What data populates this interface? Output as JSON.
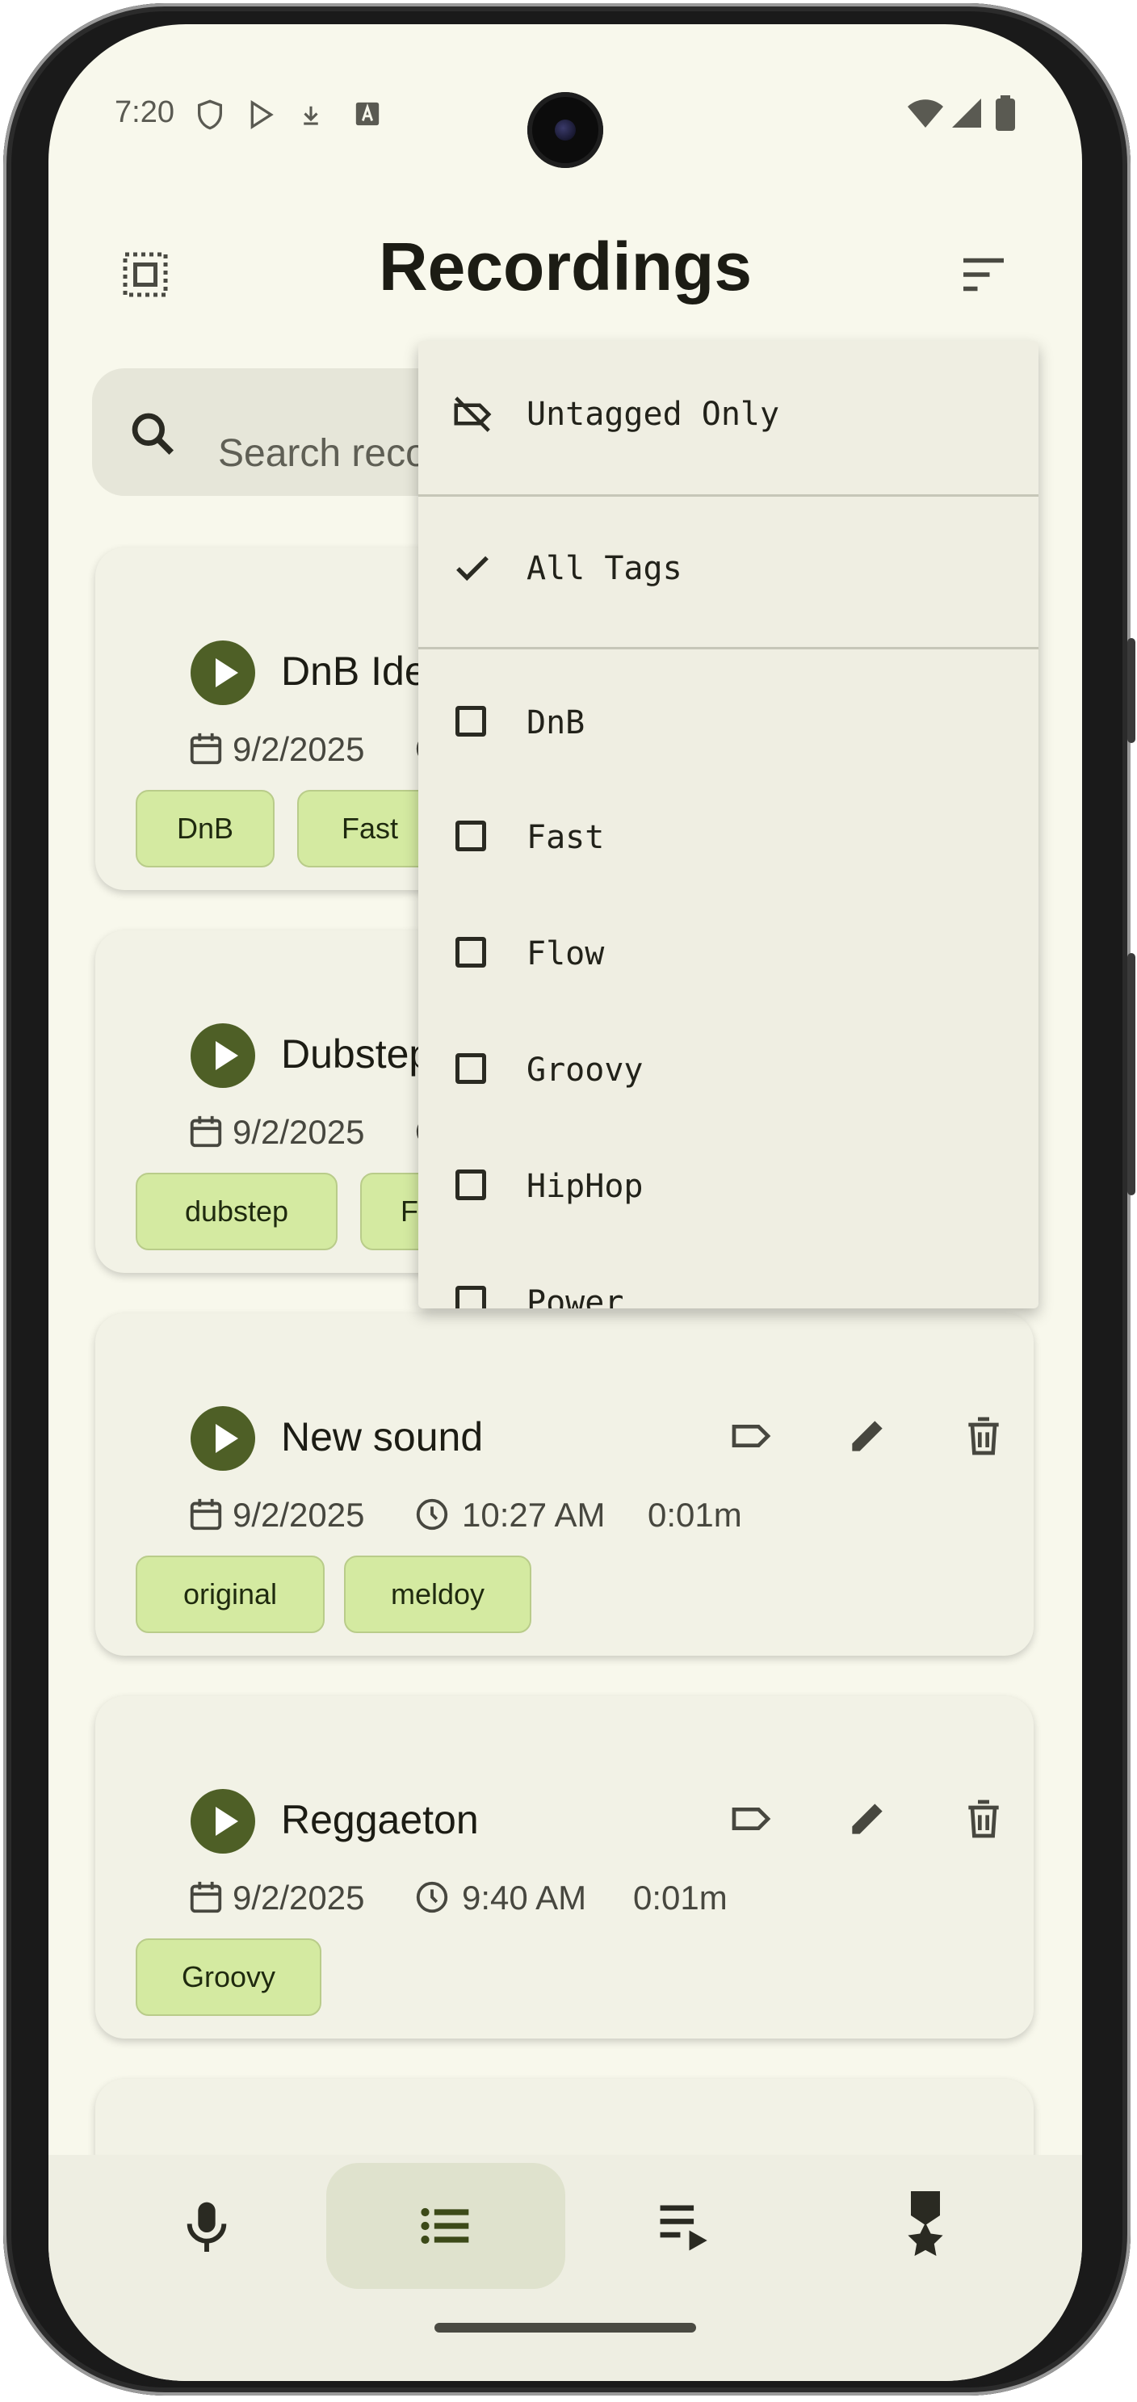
{
  "status_bar": {
    "time": "7:20"
  },
  "app_bar": {
    "title": "Recordings"
  },
  "search": {
    "placeholder": "Search recordings"
  },
  "recordings": [
    {
      "title": "DnB Idea",
      "date": "9/2/2025",
      "tags": [
        "DnB",
        "Fast"
      ]
    },
    {
      "title": "Dubstep D",
      "date": "9/2/2025",
      "tags": [
        "dubstep",
        "F"
      ]
    },
    {
      "title": "New sound",
      "date": "9/2/2025",
      "time": "10:27 AM",
      "duration": "0:01m",
      "tags": [
        "original",
        "meldoy"
      ]
    },
    {
      "title": "Reggaeton",
      "date": "9/2/2025",
      "time": "9:40 AM",
      "duration": "0:01m",
      "tags": [
        "Groovy"
      ]
    }
  ],
  "filter_menu": {
    "untagged_label": "Untagged Only",
    "all_tags_label": "All Tags",
    "all_tags_checked": true,
    "tags": [
      "DnB",
      "Fast",
      "Flow",
      "Groovy",
      "HipHop",
      "Power"
    ]
  },
  "bottom_nav": {
    "items": [
      {
        "icon": "mic-icon"
      },
      {
        "icon": "list-icon",
        "selected": true
      },
      {
        "icon": "playlist-play-icon"
      },
      {
        "icon": "military-medal-icon"
      }
    ]
  },
  "colors": {
    "background": "#f8f8ec",
    "play_button": "#4e5f26",
    "chip": "#d4eaa1",
    "menu": "#efeee2"
  }
}
